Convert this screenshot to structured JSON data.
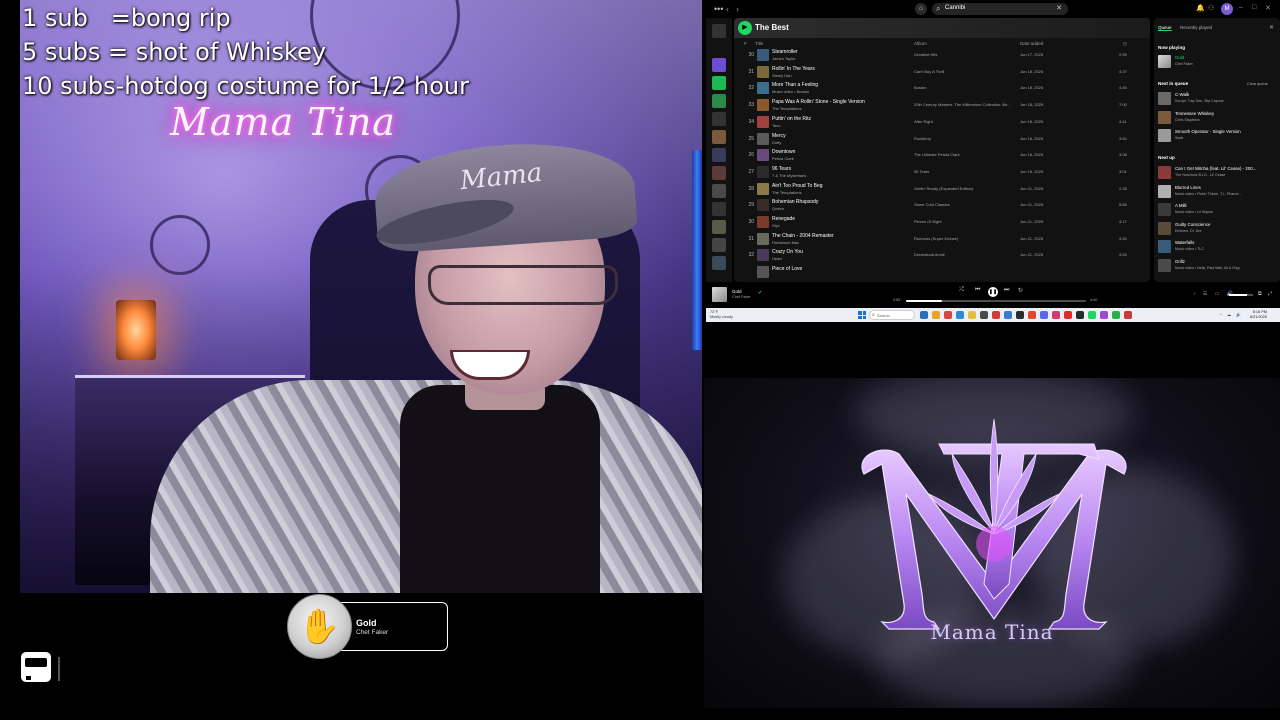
{
  "overlay": {
    "lines": [
      "1 sub   =bong rip",
      "5 subs = shot of Whiskey",
      "10 subs-hotdog costume for 1/2 hour"
    ]
  },
  "webcam": {
    "neon_sign": "Mama Tina",
    "cap_text": "Mama"
  },
  "now_playing_badge": {
    "title": "Gold",
    "artist": "Chet Faker"
  },
  "spotify": {
    "search_value": "Cannibi",
    "playlist_title": "The Best",
    "columns": {
      "num": "#",
      "title": "Title",
      "album": "Album",
      "date_added": "Date added"
    },
    "tracks": [
      {
        "num": "30",
        "title": "Steamroller",
        "artist": "James Taylor",
        "album": "Greatest Hits",
        "date": "Jun 17, 2025",
        "duration": "2:55",
        "color": "#3b5a7a"
      },
      {
        "num": "31",
        "title": "Rollin' In The Years",
        "artist": "Steely Dan",
        "album": "Can't Buy A Thrill",
        "date": "Jun 18, 2025",
        "duration": "4:37",
        "color": "#7a6a3b"
      },
      {
        "num": "32",
        "title": "More Than a Feeling",
        "artist": "Music video • Boston",
        "album": "Boston",
        "date": "Jun 18, 2025",
        "duration": "4:45",
        "color": "#3b6e8a"
      },
      {
        "num": "33",
        "title": "Papa Was A Rollin' Stone - Single Version",
        "artist": "The Temptations",
        "album": "20th Century Masters: The Millennium Collection: Be...",
        "date": "Jun 18, 2025",
        "duration": "7:00",
        "color": "#8a5a2b"
      },
      {
        "num": "34",
        "title": "Puttin' on the Ritz",
        "artist": "Taco",
        "album": "After Eight",
        "date": "Jun 18, 2025",
        "duration": "4:41",
        "color": "#a04040"
      },
      {
        "num": "25",
        "title": "Mercy",
        "artist": "Duffy",
        "album": "Rockferry",
        "date": "Jun 18, 2025",
        "duration": "3:50",
        "color": "#5a5a5a"
      },
      {
        "num": "26",
        "title": "Downtown",
        "artist": "Petula Clark",
        "album": "The Ultimate Petula Clark",
        "date": "Jun 18, 2025",
        "duration": "3:08",
        "color": "#6a4a7a"
      },
      {
        "num": "27",
        "title": "96 Tears",
        "artist": "? & The Mysterians",
        "album": "96 Tears",
        "date": "Jun 18, 2025",
        "duration": "3:01",
        "color": "#2b2b2b"
      },
      {
        "num": "28",
        "title": "Ain't Too Proud To Beg",
        "artist": "The Temptations",
        "album": "Gettin' Ready (Expanded Edition)",
        "date": "Jun 21, 2025",
        "duration": "2:38",
        "color": "#8a7a4a"
      },
      {
        "num": "29",
        "title": "Bohemian Rhapsody",
        "artist": "Queen",
        "album": "Stone Cold Classics",
        "date": "Jun 21, 2025",
        "duration": "5:55",
        "color": "#3a2a2a"
      },
      {
        "num": "30",
        "title": "Renegade",
        "artist": "Styx",
        "album": "Pieces Of Eight",
        "date": "Jun 21, 2025",
        "duration": "4:17",
        "color": "#7a3a2a"
      },
      {
        "num": "31",
        "title": "The Chain - 2004 Remaster",
        "artist": "Fleetwood Mac",
        "album": "Rumours (Super Deluxe)",
        "date": "Jun 21, 2025",
        "duration": "4:30",
        "color": "#6a6a5a"
      },
      {
        "num": "32",
        "title": "Crazy On You",
        "artist": "Heart",
        "album": "Dreamboat Annie",
        "date": "Jun 21, 2025",
        "duration": "4:53",
        "color": "#4a3a5a"
      },
      {
        "num": "",
        "title": "Piece of Love",
        "artist": "",
        "album": "",
        "date": "",
        "duration": "",
        "color": "#555555"
      }
    ],
    "queue": {
      "tab_queue": "Queue",
      "tab_recent": "Recently played",
      "now_playing_label": "Now playing",
      "now_playing": {
        "title": "Gold",
        "artist": "Chet Faker"
      },
      "next_in_queue_label": "Next in queue",
      "clear_label": "Clear queue",
      "next_in_queue": [
        {
          "title": "C-Walk",
          "artist": "Kurupt, Tray Dee, Slip Capone",
          "color": "#6a6a6a"
        },
        {
          "title": "Tennessee Whiskey",
          "artist": "Chris Stapleton",
          "color": "#7a5a3a"
        },
        {
          "title": "Smooth Operator - Single Version",
          "artist": "Sade",
          "color": "#9a9a9a"
        }
      ],
      "next_up_label": "Next up",
      "next_up": [
        {
          "title": "Can I Get Witcha (feat. Lil' Cease) - 200...",
          "artist": "The Notorious B.I.G., Lil' Cease",
          "color": "#8a3a3a"
        },
        {
          "title": "Blurred Lines",
          "artist": "Music video • Robin Thicke, T.I., Pharrel...",
          "color": "#b0b0b0"
        },
        {
          "title": "A Milli",
          "artist": "Music video • Lil Wayne",
          "color": "#3a3a3a"
        },
        {
          "title": "Guilty Conscience",
          "artist": "Eminem, Dr. Dre",
          "color": "#5a4a3a"
        },
        {
          "title": "Waterfalls",
          "artist": "Music video • TLC",
          "color": "#3a5a7a"
        },
        {
          "title": "Grillz",
          "artist": "Music video • Nelly, Paul Wall, Ali & Gipp",
          "color": "#4a4a4a"
        }
      ]
    },
    "player": {
      "title": "Gold",
      "artist": "Chet Faker",
      "elapsed": "0:55",
      "total": "4:40",
      "progress": 0.2,
      "volume": 0.75
    }
  },
  "taskbar": {
    "weather_temp": "72°F",
    "weather_desc": "Mostly cloudy",
    "search_placeholder": "Search",
    "time": "5:16 PM",
    "date": "6/21/2025"
  },
  "logo": {
    "brand": "Mama Tina",
    "accent": "#b98af5"
  }
}
